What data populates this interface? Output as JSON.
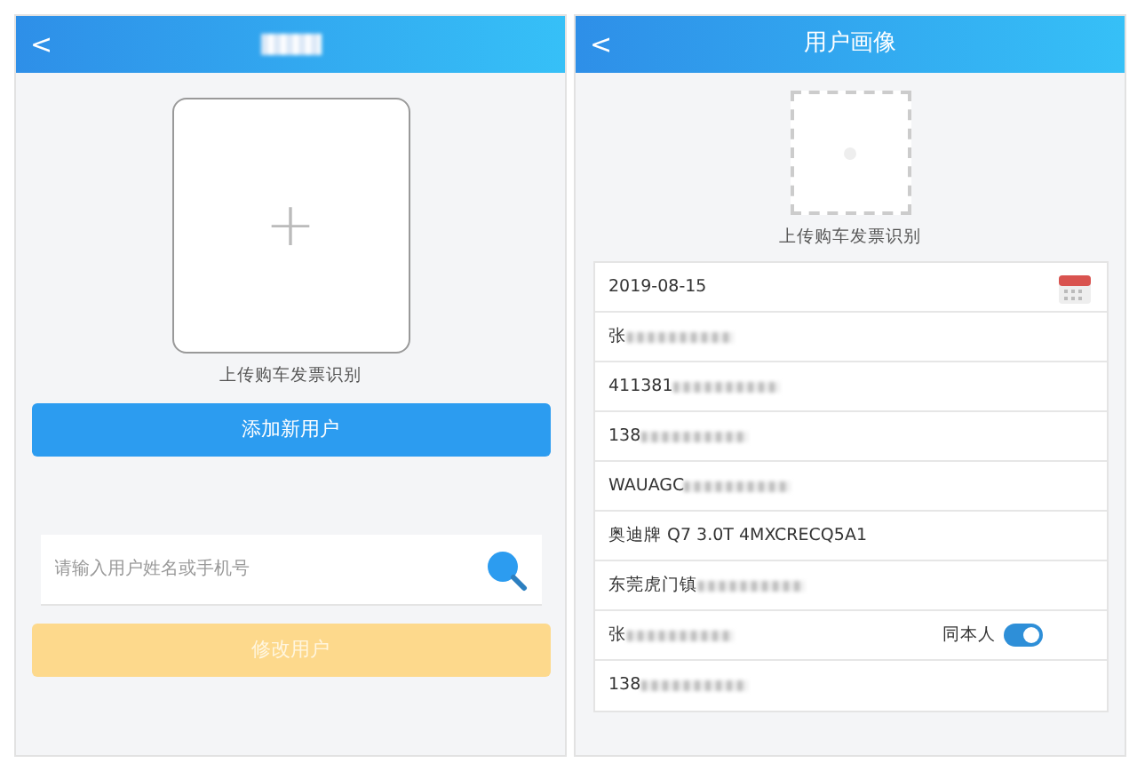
{
  "left": {
    "header": {
      "back": "<"
    },
    "upload": {
      "plus": "+",
      "caption": "上传购车发票识别"
    },
    "add_button": "添加新用户",
    "search": {
      "placeholder": "请输入用户姓名或手机号"
    },
    "modify_button": {
      "label": "修改用户",
      "disabled": true
    }
  },
  "right": {
    "header": {
      "back": "<",
      "title": "用户画像"
    },
    "upload": {
      "caption": "上传购车发票识别"
    },
    "rows": [
      {
        "kind": "date",
        "text": "2019-08-15"
      },
      {
        "kind": "text",
        "text": "张",
        "blurred": true
      },
      {
        "kind": "text",
        "text": "411381",
        "blurred": true
      },
      {
        "kind": "text",
        "text": "138",
        "blurred": true
      },
      {
        "kind": "text",
        "text": "WAUAGC",
        "blurred": true
      },
      {
        "kind": "text",
        "text": "奥迪牌 Q7 3.0T 4MXCRECQ5A1",
        "blurred": false
      },
      {
        "kind": "text",
        "text": "东莞虎门镇",
        "blurred": true
      },
      {
        "kind": "toggle",
        "text": "张",
        "blurred": true,
        "toggle_label": "同本人",
        "on": true
      },
      {
        "kind": "text",
        "text": "138",
        "blurred": true
      }
    ]
  }
}
